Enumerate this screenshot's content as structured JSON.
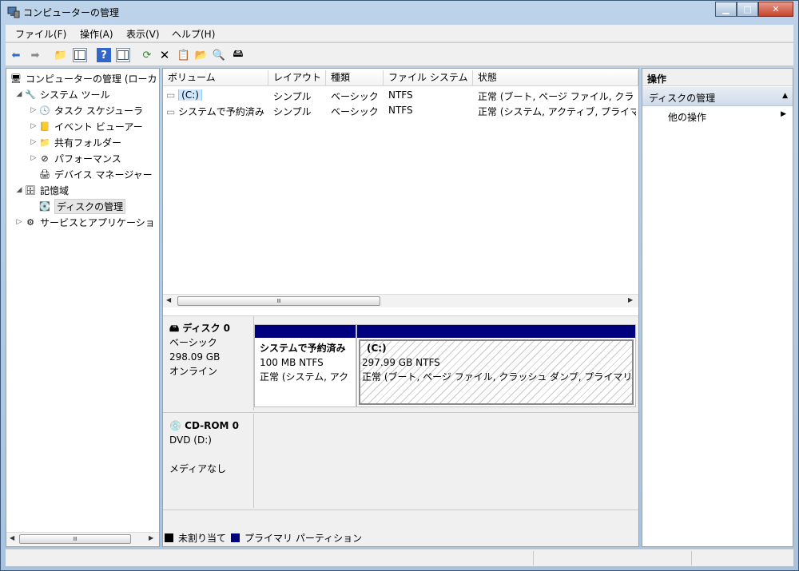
{
  "window": {
    "title": "コンピューターの管理"
  },
  "menu": {
    "items": [
      "ファイル(F)",
      "操作(A)",
      "表示(V)",
      "ヘルプ(H)"
    ]
  },
  "tree": {
    "items": [
      {
        "label": "コンピューターの管理 (ローカ",
        "icon": "computer-icon"
      },
      {
        "label": "システム ツール",
        "icon": "tools-icon"
      },
      {
        "label": "タスク スケジューラ",
        "icon": "clock-icon"
      },
      {
        "label": "イベント ビューアー",
        "icon": "event-viewer-icon"
      },
      {
        "label": "共有フォルダー",
        "icon": "shared-folder-icon"
      },
      {
        "label": "パフォーマンス",
        "icon": "performance-icon"
      },
      {
        "label": "デバイス マネージャー",
        "icon": "device-manager-icon"
      },
      {
        "label": "記憶域",
        "icon": "storage-icon"
      },
      {
        "label": "ディスクの管理",
        "icon": "disk-management-icon"
      },
      {
        "label": "サービスとアプリケーショ",
        "icon": "services-icon"
      }
    ],
    "scroll_thumb": "Ⅲ"
  },
  "volumes": {
    "columns": [
      "ボリューム",
      "レイアウト",
      "種類",
      "ファイル システム",
      "状態"
    ],
    "rows": [
      [
        "(C:)",
        "シンプル",
        "ベーシック",
        "NTFS",
        "正常 (ブート, ページ ファイル, クラ"
      ],
      [
        "システムで予約済み",
        "シンプル",
        "ベーシック",
        "NTFS",
        "正常 (システム, アクティブ, プライマ"
      ]
    ],
    "scroll_thumb": "Ⅲ"
  },
  "disks": {
    "disk0": {
      "title": "ディスク 0",
      "type": "ベーシック",
      "size": "298.09 GB",
      "status": "オンライン",
      "partitions": [
        {
          "name": "システムで予約済み",
          "size": "100 MB NTFS",
          "status": "正常 (システム, アク"
        },
        {
          "name": "(C:)",
          "size": "297.99 GB NTFS",
          "status": "正常 (ブート, ページ ファイル, クラッシュ ダンプ, プライマリ"
        }
      ]
    },
    "cdrom0": {
      "title": "CD-ROM 0",
      "drive": "DVD (D:)",
      "status": "メディアなし"
    }
  },
  "legend": {
    "unallocated": "未割り当て",
    "primary": "プライマリ パーティション",
    "colors": {
      "unallocated": "#000000",
      "primary": "#00007f"
    }
  },
  "actions": {
    "header": "操作",
    "section": "ディスクの管理",
    "item": "他の操作"
  }
}
